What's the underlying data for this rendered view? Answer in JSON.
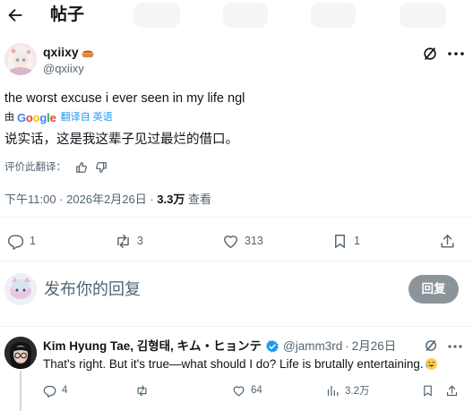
{
  "header": {
    "title": "帖子"
  },
  "author": {
    "name": "qxiixy",
    "handle": "@qxiixy"
  },
  "post": {
    "text": "the worst excuse i ever seen in my life ngl",
    "translate_by": "由",
    "translate_brand": "Google",
    "translate_label": "翻译自 英语",
    "translated_text": "说实话，这是我这辈子见过最烂的借口。",
    "rate_label": "评价此翻译：",
    "time": "下午11:00 · 2026年2月26日 · ",
    "views": "3.3万",
    "views_label": " 查看"
  },
  "stats": {
    "replies": "1",
    "reposts": "3",
    "likes": "313",
    "bookmarks": "1"
  },
  "composer": {
    "placeholder": "发布你的回复",
    "reply_button": "回复"
  },
  "reply": {
    "name": "Kim Hyung Tae, 김형태, キム・ヒョンテ",
    "handle": "@jamm3rd",
    "separator": "·",
    "date": "2月26日",
    "text": "That's right. But it's true—what should I do? Life is brutally entertaining.",
    "replies": "4",
    "likes": "64",
    "views": "3.2万"
  },
  "colors": {
    "accent": "#1d9bf0",
    "text": "#0f1419",
    "muted": "#536471",
    "reply_button": "#8b9499",
    "divider": "#eff3f4"
  },
  "icons": [
    "back-arrow-icon",
    "grok-icon",
    "more-icon",
    "thumbs-up-icon",
    "thumbs-down-icon",
    "reply-icon",
    "repost-icon",
    "like-icon",
    "bookmark-icon",
    "share-icon",
    "verified-icon",
    "views-icon",
    "emoji-icon"
  ]
}
